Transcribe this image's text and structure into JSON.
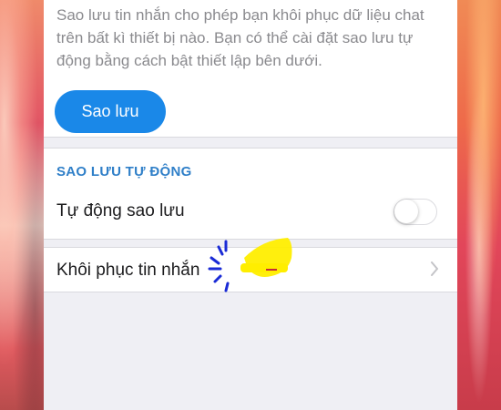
{
  "description": "Sao lưu tin nhắn cho phép bạn khôi phục dữ liệu chat trên bất kì thiết bị nào. Bạn có thể cài đặt sao lưu tự động bằng cách bật thiết lập bên dưới.",
  "backup_button": {
    "label": "Sao lưu"
  },
  "auto_backup": {
    "section_title": "SAO LƯU TỰ ĐỘNG",
    "toggle_label": "Tự động sao lưu",
    "toggle_on": false
  },
  "restore": {
    "label": "Khôi phục tin nhắn"
  },
  "colors": {
    "accent": "#1a88e8",
    "section": "#2f7fc8",
    "highlighter": "#ffee00"
  },
  "icons": [
    "chevron-right-icon",
    "toggle-switch"
  ]
}
